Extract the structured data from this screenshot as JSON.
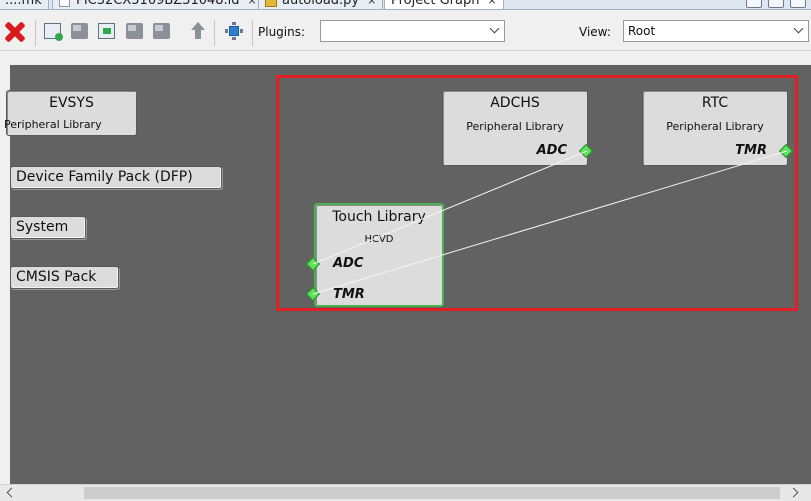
{
  "tabs": [
    {
      "label": "....mk",
      "active": false
    },
    {
      "label": "PIC32CX5109BZ31048.ld",
      "active": false
    },
    {
      "label": "autoload.py",
      "active": false
    },
    {
      "label": "Project Graph",
      "active": true
    }
  ],
  "tab_close_glyph": "×",
  "toolbar": {
    "plugins_label": "Plugins:",
    "plugins_value": "",
    "view_label": "View:",
    "view_value": "Root"
  },
  "side_components": [
    {
      "title": "EVSYS",
      "subtitle": "Peripheral Library"
    },
    {
      "label": "Device Family Pack (DFP)"
    },
    {
      "label": "System"
    },
    {
      "label": "CMSIS Pack"
    }
  ],
  "graph_nodes": {
    "adchs": {
      "title": "ADCHS",
      "subtitle": "Peripheral Library",
      "port": "ADC"
    },
    "rtc": {
      "title": "RTC",
      "subtitle": "Peripheral Library",
      "port": "TMR"
    },
    "touch": {
      "title": "Touch Library",
      "subtitle": "HCVD",
      "ports": [
        "ADC",
        "TMR"
      ]
    }
  },
  "colors": {
    "canvas": "#626262",
    "node": "#dcdcdc",
    "selection": "#e31e24",
    "connector": "#5ce25c",
    "touch_border": "#4caf50"
  },
  "icons": [
    "delete-icon",
    "add-component-icon",
    "remove-component-icon",
    "import-icon",
    "grey-component-icon",
    "group-icon",
    "up-arrow-icon",
    "chip-icon"
  ]
}
